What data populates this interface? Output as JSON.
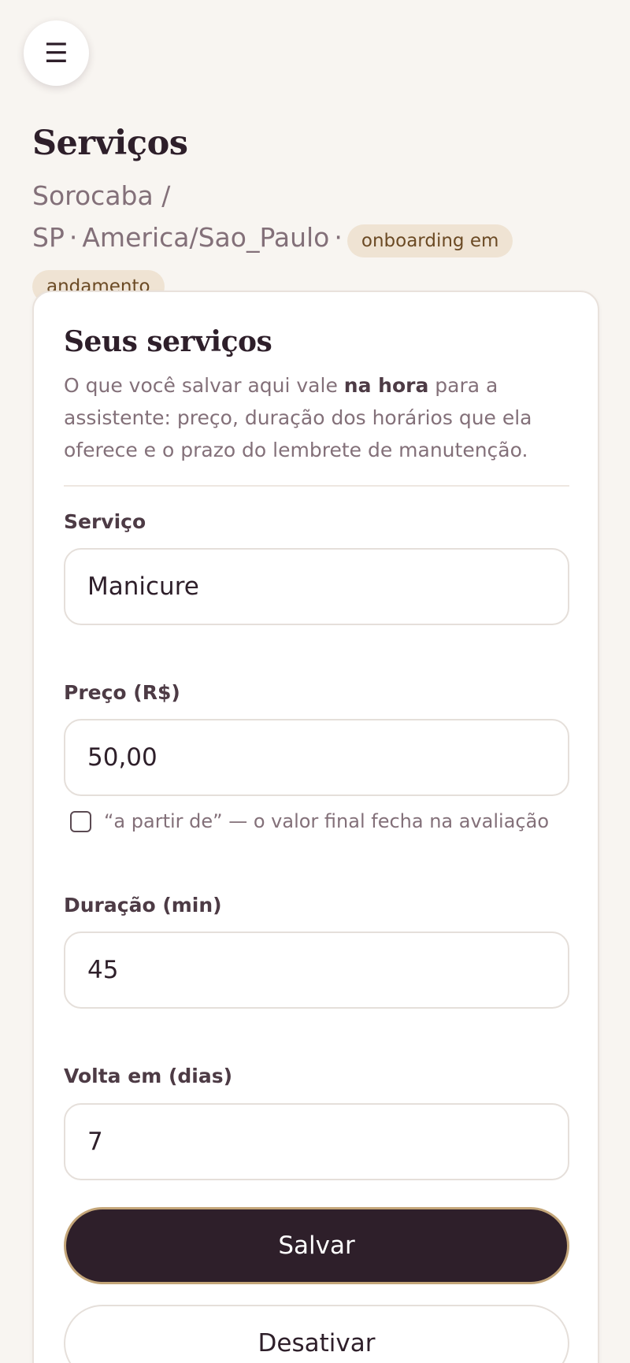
{
  "header": {
    "menu_icon": "hamburger-icon",
    "menu_glyph": "☰",
    "title": "Serviços",
    "location": "Sorocaba / SP",
    "separator": "·",
    "timezone": "America/Sao_Paulo",
    "status_badge": "onboarding em andamento"
  },
  "card": {
    "title": "Seus serviços",
    "desc_prefix": "O que você salvar aqui vale ",
    "desc_bold": "na hora",
    "desc_suffix": " para a assistente: preço, duração dos horários que ela oferece e o prazo do lembrete de manutenção."
  },
  "form": {
    "service": {
      "label": "Serviço",
      "value": "Manicure"
    },
    "price": {
      "label": "Preço (R$)",
      "value": "50,00"
    },
    "price_from": {
      "label": "“a partir de” — o valor final fecha na avaliação",
      "checked": false
    },
    "duration": {
      "label": "Duração (min)",
      "value": "45"
    },
    "return_days": {
      "label": "Volta em (dias)",
      "value": "7"
    }
  },
  "actions": {
    "save_label": "Salvar",
    "deactivate_label": "Desativar"
  },
  "colors": {
    "background": "#f8f5f1",
    "primary": "#2e1f2a",
    "accent_border": "#c4a679",
    "badge_bg": "#efe3d3",
    "badge_text": "#6b4a24",
    "muted_text": "#837079"
  }
}
